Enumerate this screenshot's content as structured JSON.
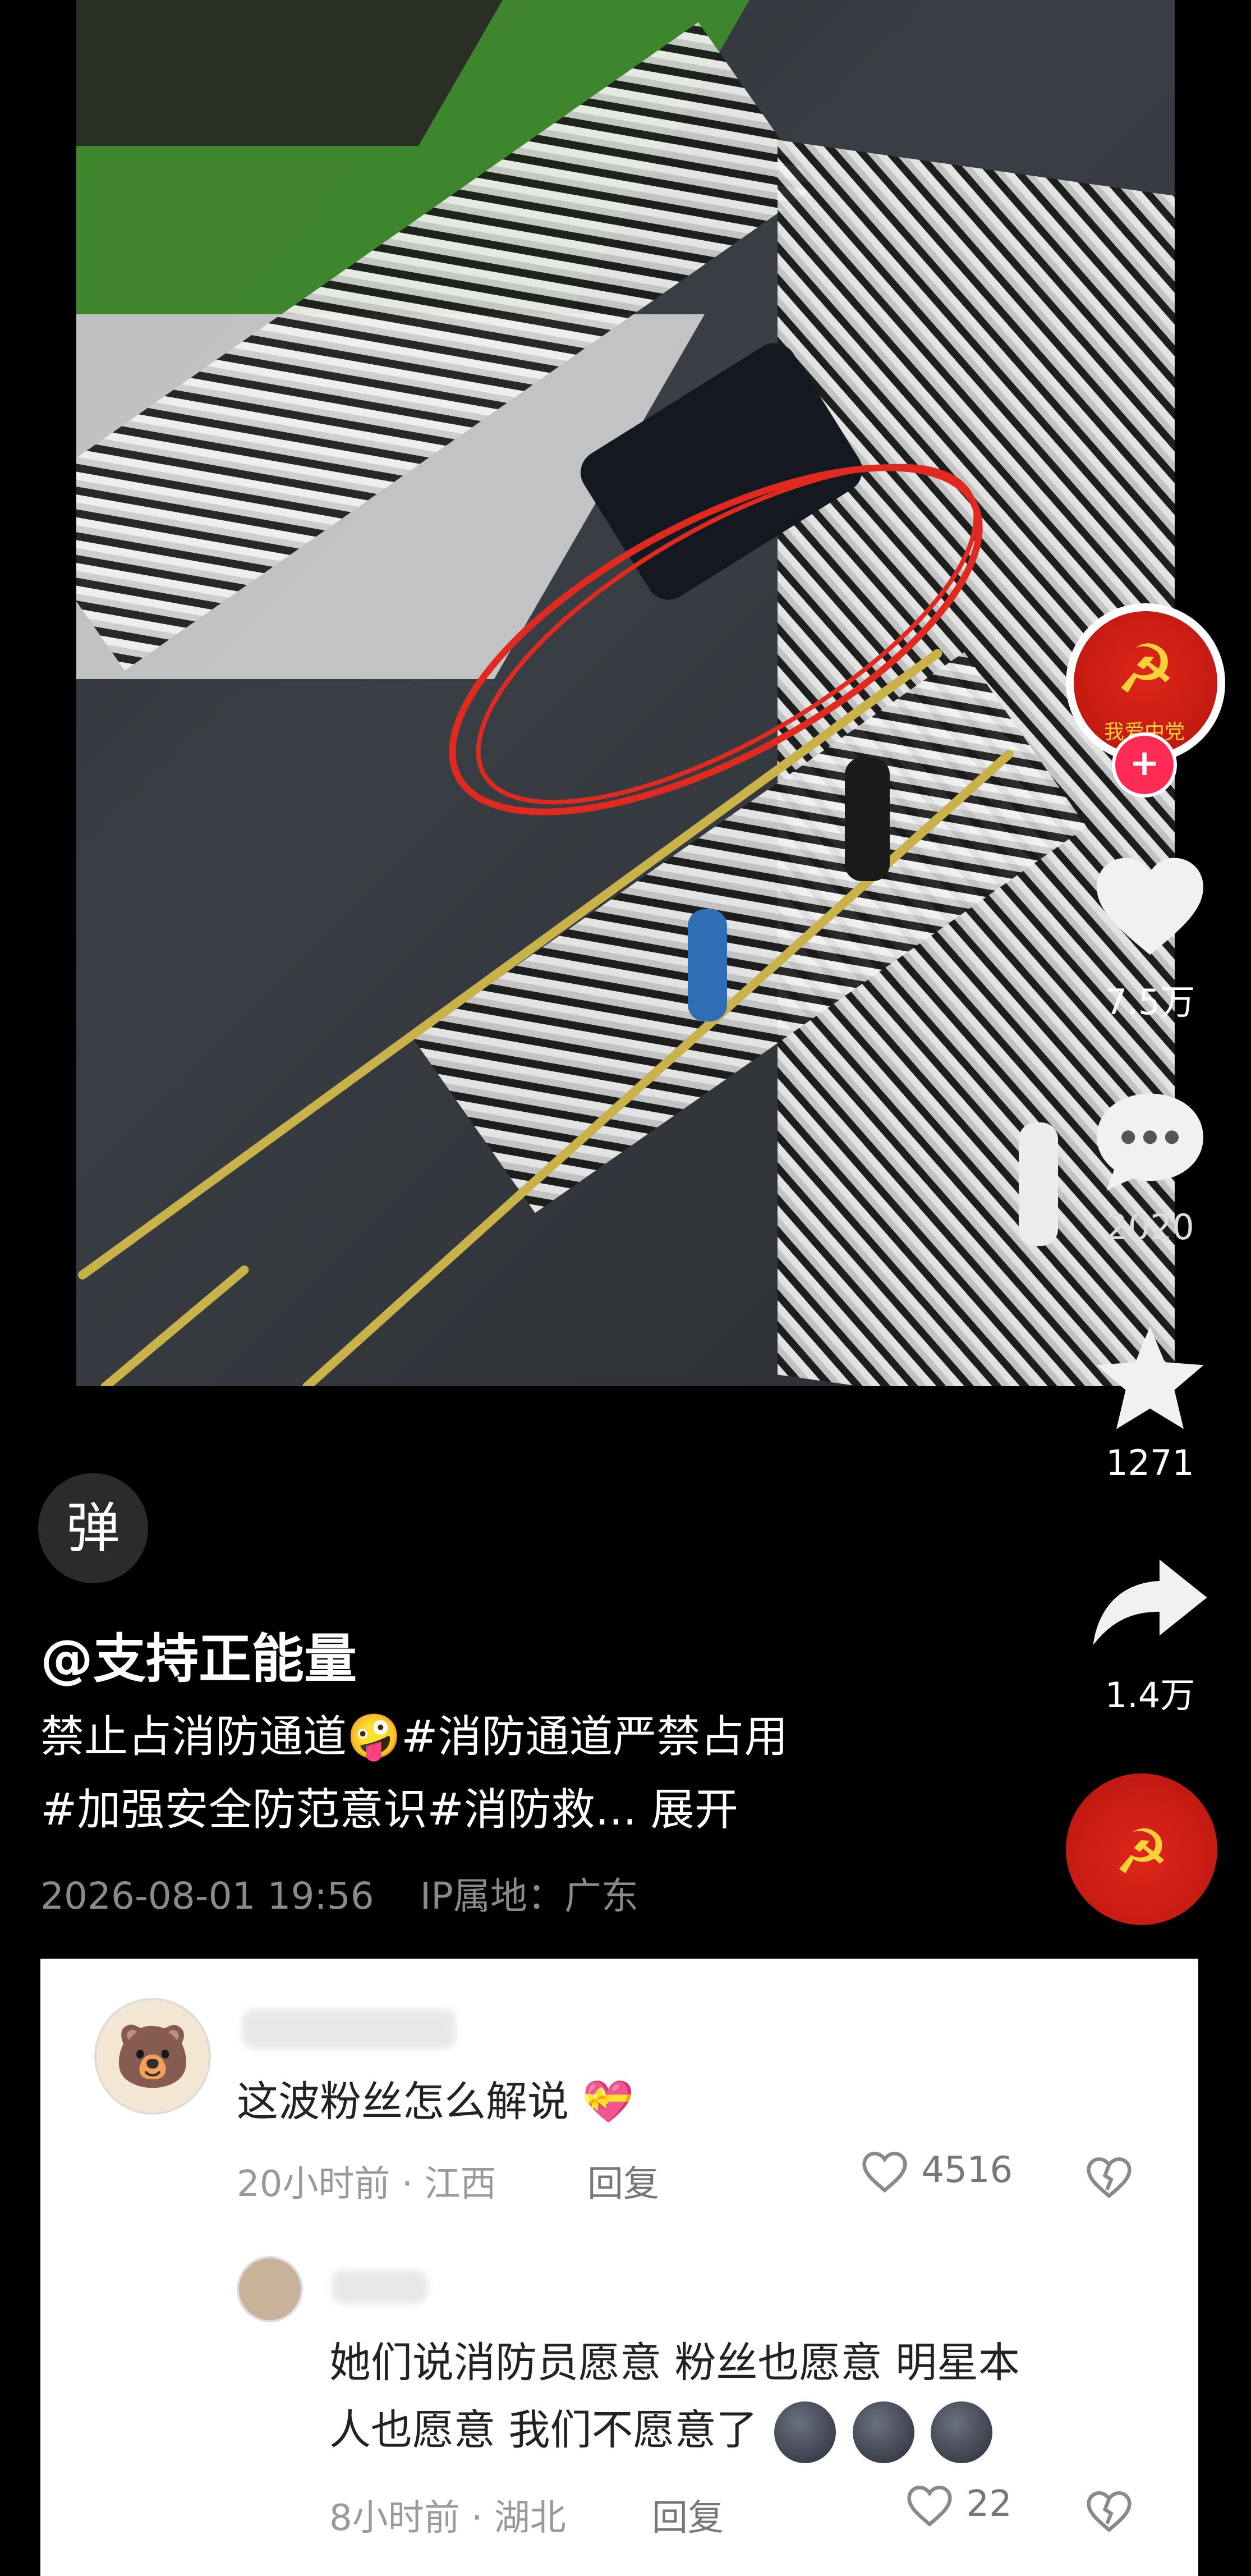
{
  "video": {
    "annotation": "red-circle-around-car"
  },
  "rail": {
    "account_badge_text": "我爱中党",
    "likes": "7.5万",
    "comments": "2020",
    "favorites": "1271",
    "shares": "1.4万"
  },
  "caption": {
    "danmaku_button": "弹",
    "author": "@支持正能量",
    "line1": "禁止占消防通道🤪#消防通道严禁占用",
    "line2": "#加强安全防范意识#消防救... 展开",
    "timestamp": "2026-08-01 19:56",
    "ip_label": "IP属地：广东"
  },
  "comments": [
    {
      "text": "这波粉丝怎么解说",
      "emoji": "💝",
      "time": "20小时前",
      "location": "江西",
      "reply_label": "回复",
      "likes": "4516"
    },
    {
      "text_line1": "她们说消防员愿意 粉丝也愿意 明星本",
      "text_line2": "人也愿意 我们不愿意了",
      "time": "8小时前",
      "location": "湖北",
      "reply_label": "回复",
      "likes": "22"
    }
  ],
  "colors": {
    "accent_red": "#e0261b",
    "plus_badge": "#fe2c55",
    "background": "#000000",
    "comment_panel": "#ffffff"
  }
}
